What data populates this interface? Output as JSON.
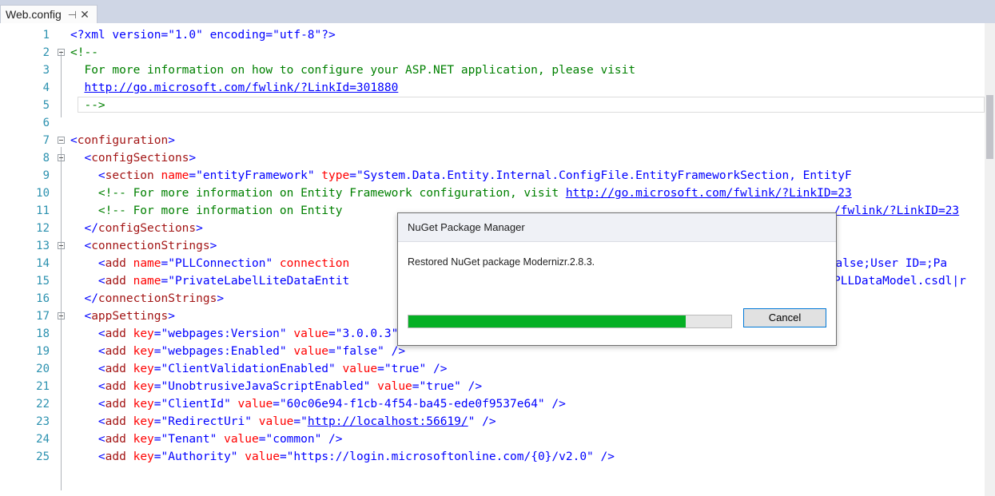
{
  "tab": {
    "title": "Web.config",
    "pin_icon": "pin-icon",
    "close_icon": "close-icon"
  },
  "lines": [
    {
      "n": "1"
    },
    {
      "n": "2"
    },
    {
      "n": "3"
    },
    {
      "n": "4"
    },
    {
      "n": "5"
    },
    {
      "n": "6"
    },
    {
      "n": "7"
    },
    {
      "n": "8"
    },
    {
      "n": "9"
    },
    {
      "n": "10"
    },
    {
      "n": "11"
    },
    {
      "n": "12"
    },
    {
      "n": "13"
    },
    {
      "n": "14"
    },
    {
      "n": "15"
    },
    {
      "n": "16"
    },
    {
      "n": "17"
    },
    {
      "n": "18"
    },
    {
      "n": "19"
    },
    {
      "n": "20"
    },
    {
      "n": "21"
    },
    {
      "n": "22"
    },
    {
      "n": "23"
    },
    {
      "n": "24"
    },
    {
      "n": "25"
    }
  ],
  "code": {
    "l1": [
      "<?xml version=\"1.0\" encoding=\"utf-8\"?>"
    ],
    "l2": [
      "<!--"
    ],
    "l3": [
      "  For more information on how to configure your ASP.NET application, please visit"
    ],
    "l4": [
      "http://go.microsoft.com/fwlink/?LinkId=301880"
    ],
    "l5": [
      "  -->"
    ],
    "l7": [
      "<",
      "configuration",
      ">"
    ],
    "l8": [
      "  <",
      "configSections",
      ">"
    ],
    "l9": [
      "    <",
      "section",
      " name",
      "=\"entityFramework\"",
      " type",
      "=\"System.Data.Entity.Internal.ConfigFile.EntityFrameworkSection, EntityF"
    ],
    "l10": [
      "    <!-- For more information on Entity Framework configuration, visit ",
      "http://go.microsoft.com/fwlink/?LinkID=23"
    ],
    "l11": [
      "    <!-- For more information on Entity",
      "/fwlink/?LinkID=23"
    ],
    "l12": [
      "  </",
      "configSections",
      ">"
    ],
    "l13": [
      "  <",
      "connectionStrings",
      ">"
    ],
    "l14": [
      "    <",
      "add",
      " name",
      "=\"PLLConnection\"",
      " connection",
      "=False;User ID=;Pa"
    ],
    "l15": [
      "    <",
      "add",
      " name",
      "=\"PrivateLabelLiteDataEntit",
      "PLLDataModel.csdl|r"
    ],
    "l16": [
      "  </",
      "connectionStrings",
      ">"
    ],
    "l17": [
      "  <",
      "appSettings",
      ">"
    ],
    "l18": [
      "    <",
      "add",
      " key",
      "=\"webpages:Version\"",
      " value",
      "=\"3.0.0.3\"",
      " />"
    ],
    "l19": [
      "    <",
      "add",
      " key",
      "=\"webpages:Enabled\"",
      " value",
      "=\"false\"",
      " />"
    ],
    "l20": [
      "    <",
      "add",
      " key",
      "=\"ClientValidationEnabled\"",
      " value",
      "=\"true\"",
      " />"
    ],
    "l21": [
      "    <",
      "add",
      " key",
      "=\"UnobtrusiveJavaScriptEnabled\"",
      " value",
      "=\"true\"",
      " />"
    ],
    "l22": [
      "    <",
      "add",
      " key",
      "=\"ClientId\"",
      " value",
      "=\"60c06e94-f1cb-4f54-ba45-ede0f9537e64\"",
      " />"
    ],
    "l23": [
      "    <",
      "add",
      " key",
      "=\"RedirectUri\"",
      " value",
      "=\"",
      "http://localhost:56619/",
      "\"",
      " />"
    ],
    "l24": [
      "    <",
      "add",
      " key",
      "=\"Tenant\"",
      " value",
      "=\"common\"",
      " />"
    ],
    "l25": [
      "    <",
      "add",
      " key",
      "=\"Authority\"",
      " value",
      "=\"https://login.microsoftonline.com/{0}/v2.0\"",
      " />"
    ]
  },
  "dialog": {
    "title": "NuGet Package Manager",
    "message": "Restored NuGet package Modernizr.2.8.3.",
    "progress": 0.86,
    "cancel_label": "Cancel"
  },
  "colors": {
    "progress_fill": "#06b025",
    "line_number": "#2b91af"
  }
}
